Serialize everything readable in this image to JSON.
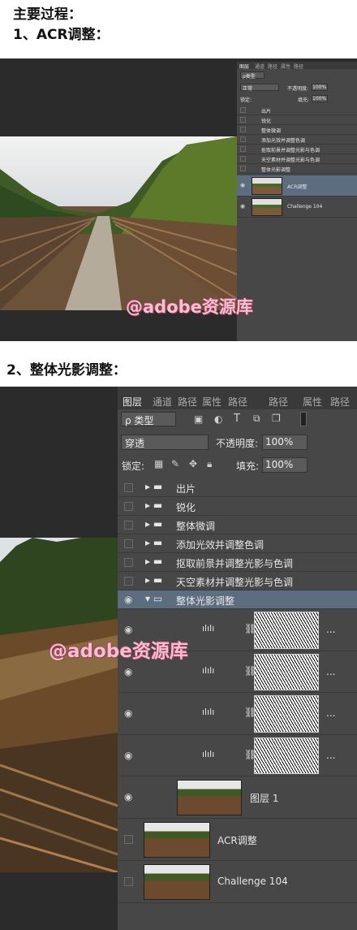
{
  "headings": {
    "main": "主要过程：",
    "step1": "1、ACR调整：",
    "step2": "2、整体光影调整："
  },
  "watermark": "@adobe资源库",
  "panel_small": {
    "tabs": [
      "图层",
      "通道",
      "路径",
      "属性",
      "路径"
    ],
    "kind_label": "ρ类型",
    "blend_mode": "正常",
    "opacity_label": "不透明度:",
    "opacity_value": "100%",
    "lock_label": "锁定:",
    "fill_label": "填充:",
    "fill_value": "100%",
    "groups": [
      "出片",
      "锐化",
      "整体微调",
      "添加光效并调整色调",
      "抠取前景并调整光影与色调",
      "天空素材并调整光影与色调",
      "整体光影调整"
    ],
    "layers": [
      "ACR调整",
      "Challenge 104"
    ]
  },
  "panel_large": {
    "tabs": [
      "图层",
      "通道",
      "路径",
      "属性",
      "路径",
      "路径",
      "属性",
      "路径"
    ],
    "kind_label": "ρ 类型",
    "blend_mode": "穿透",
    "opacity_label": "不透明度:",
    "opacity_value": "100%",
    "lock_label": "锁定:",
    "fill_label": "填充:",
    "fill_value": "100%",
    "groups": [
      "出片",
      "锐化",
      "整体微调",
      "添加光效并调整色调",
      "抠取前景并调整光影与色调",
      "天空素材并调整光影与色调",
      "整体光影调整"
    ],
    "layer1": "图层 1",
    "layers": [
      "ACR调整",
      "Challenge 104"
    ],
    "ellipsis": "..."
  },
  "colors": {
    "panel_bg": "#474747",
    "selected_row": "#5d6d80",
    "dark_bg": "#2b2b2b"
  }
}
